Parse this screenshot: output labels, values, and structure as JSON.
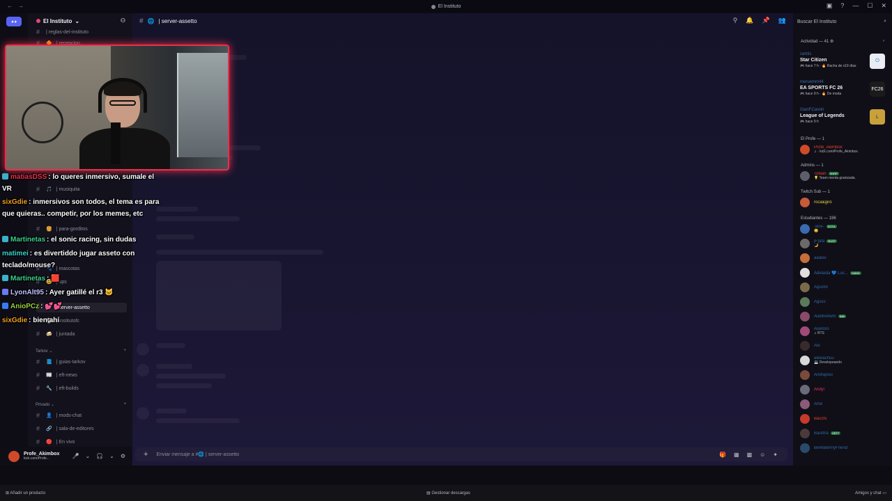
{
  "window": {
    "title": "El Instituto",
    "nav_back": "←",
    "nav_fwd": "→",
    "win_controls": [
      "▣",
      "?",
      "—",
      "☐",
      "✕"
    ]
  },
  "server": {
    "name": "El Instituto",
    "chevron": "⌄"
  },
  "channels": {
    "top_cut": "| reglas-del-instituto",
    "items": [
      {
        "label": "| recepcion",
        "icon": "🔶"
      },
      {
        "label": "| musiquita",
        "icon": "🎵"
      },
      {
        "label": "| para-gorditos",
        "icon": "🍔"
      },
      {
        "label": "| mascotas",
        "icon": "🐾"
      },
      {
        "label": "| ups",
        "icon": "😅"
      },
      {
        "label": "| server-assetto",
        "icon": "🌐"
      },
      {
        "label": "| institutofc",
        "icon": "⚽"
      },
      {
        "label": "| juntada",
        "icon": "🍻"
      }
    ],
    "cat_tarkov": "Tarkov ⌄",
    "tarkov": [
      {
        "label": "| guias-tarkov",
        "icon": "📘"
      },
      {
        "label": "| eft-news",
        "icon": "📰"
      },
      {
        "label": "| eft-builds",
        "icon": "🔧"
      }
    ],
    "cat_privado": "Privado ⌄",
    "privado": [
      {
        "label": "| mods-chat",
        "icon": "👤"
      },
      {
        "label": "| sala-de-editores",
        "icon": "🔗"
      },
      {
        "label": "| En vivo",
        "icon": "🔴"
      }
    ],
    "add": "+"
  },
  "user": {
    "name": "Profe_Akimbox",
    "status": "kick.com/Profe...",
    "controls": [
      "🎤",
      "⌄",
      "🎧",
      "⌄",
      "⚙"
    ]
  },
  "main": {
    "channel": "| server-assetto",
    "channel_icon": "🌐",
    "composer_placeholder": "Enviar mensaje a #🌐 | server-assetto",
    "composer_plus": "+",
    "composer_tools": [
      "🎁",
      "▦",
      "▩",
      "☺",
      "✦"
    ],
    "head_icons": [
      "⚲",
      "🔔",
      "📌",
      "👥"
    ]
  },
  "members": {
    "search_placeholder": "Buscar El Instituto",
    "search_icon": "⌕",
    "activity_header": "Actividad — 41 ⚙",
    "activity_arrow": "›",
    "activities": [
      {
        "user": "ramtis",
        "game": "Star Citizen",
        "time": "🎮 hace 7 h · 🔥 Racha de x19 días",
        "icon_text": "⏻",
        "icon_color": "#e9edf2",
        "icon_fg": "#1b6ac9"
      },
      {
        "user": "meruemm44",
        "game": "EA SPORTS FC 26",
        "time": "🎮 hace 9 h · 🔥 De moda",
        "icon_text": "FC26",
        "icon_color": "#1b1b1b",
        "icon_fg": "#fff"
      },
      {
        "user": "GianFCaretti",
        "game": "League of Legends",
        "time": "🎮 hace 9 h",
        "icon_text": "L",
        "icon_color": "#c9a13a",
        "icon_fg": "#0d2a3a"
      }
    ],
    "roles": [
      {
        "header": "El Profe — 1",
        "members": [
          {
            "name": "Profe_Akimbox",
            "status": "♫ · kick.com/Profe_Akimbox",
            "color": "#e8412a",
            "avatar": "#d04a2a"
          }
        ]
      },
      {
        "header": "Admins — 1",
        "members": [
          {
            "name": "Tobian",
            "status": "💡 Team menta granizada.",
            "color": "#e8412a",
            "avatar": "#5e5e6a",
            "badge": "SHRP"
          }
        ]
      },
      {
        "header": "Twitch Sub — 1",
        "members": [
          {
            "name": "roca&giro",
            "status": "",
            "color": "#e6d53b",
            "avatar": "#c75a3a"
          }
        ]
      },
      {
        "header": "Estudiantes — 196",
        "members": [
          {
            "name": "-xirix-",
            "status": "😊",
            "color": "#2e6aa8",
            "avatar": "#3a6ab0",
            "badge": "DOTA"
          },
          {
            "name": "[F]afa",
            "status": "🌙",
            "color": "#2e6aa8",
            "avatar": "#6a6a6a",
            "badge": "RUST"
          },
          {
            "name": "aaalex",
            "status": "",
            "color": "#2e6aa8",
            "avatar": "#c56e3a"
          },
          {
            "name": "Adelaida 💙 Luc...",
            "status": "",
            "color": "#2e6aa8",
            "avatar": "#e0e0e0",
            "badge": "DMND"
          },
          {
            "name": "Agustin",
            "status": "",
            "color": "#2e6aa8",
            "avatar": "#7a6a4a"
          },
          {
            "name": "Agüss",
            "status": "",
            "color": "#2e6aa8",
            "avatar": "#5a7a5a"
          },
          {
            "name": "Alanbretwm",
            "status": "",
            "color": "#2e6aa8",
            "avatar": "#8a4a6a",
            "badge": "64th"
          },
          {
            "name": "Alaxtors",
            "status": "♫ BTS",
            "color": "#2e6aa8",
            "avatar": "#a04a7a"
          },
          {
            "name": "Ale",
            "status": "",
            "color": "#2e6aa8",
            "avatar": "#3a2a2a"
          },
          {
            "name": "alewachuu",
            "status": "💻 Developeando",
            "color": "#2e6aa8",
            "avatar": "#d8d8d8"
          },
          {
            "name": "Andrajoso",
            "status": "",
            "color": "#2e6aa8",
            "avatar": "#7a4a3a"
          },
          {
            "name": "Andy!",
            "status": "",
            "color": "#e8315a",
            "avatar": "#6a6a7a"
          },
          {
            "name": "Artie",
            "status": "",
            "color": "#2e6aa8",
            "avatar": "#8a5a7a"
          },
          {
            "name": "Bacchi",
            "status": "",
            "color": "#e8412a",
            "avatar": "#c53a2a"
          },
          {
            "name": "Bautitra",
            "status": "",
            "color": "#2e6aa8",
            "avatar": "#4a3a3a",
            "badge": "OEFT"
          },
          {
            "name": "BeWatermyFriend",
            "status": "",
            "color": "#2e6aa8",
            "avatar": "#2a4a6a"
          }
        ]
      }
    ]
  },
  "chat_overlay": [
    {
      "user": "matiasDSS",
      "user_color": "#e8314a",
      "text": ": lo queres inmersivo, sumale el VR",
      "badge_color": "#3ab0c9"
    },
    {
      "user": "sixGdie",
      "user_color": "#f0a020",
      "text": ": inmersivos son todos, el tema es para que quieras.. competir, por los memes, etc",
      "badge_color": ""
    },
    {
      "user": "Martinetas",
      "user_color": "#3ad08a",
      "text": ": el sonic racing, sin dudas",
      "badge_color": "#3ab0c9"
    },
    {
      "user": "matimei",
      "user_color": "#3ad0c9",
      "text": ": es divertiddo jugar asseto con teclado/mouse?",
      "badge_color": ""
    },
    {
      "user": "Martinetas",
      "user_color": "#3ad08a",
      "text": ": 🟥",
      "badge_color": "#3ab0c9"
    },
    {
      "user": "LyonAlt95",
      "user_color": "#c0c4ff",
      "text": ": Ayer gatillé el r3 🐱",
      "badge_color": "#6a7af0"
    },
    {
      "user": "AnioPCz",
      "user_color": "#9ad03a",
      "text": ": 💕💕",
      "badge_color": "#3a7af0"
    },
    {
      "user": "sixGdie",
      "user_color": "#f0a020",
      "text": ": bien ahí",
      "badge_color": ""
    }
  ],
  "taskbar": {
    "left": "⊞ Añadir un producto",
    "center": "▤ Gestionar descargas",
    "right": "Amigos y chat ▭"
  }
}
